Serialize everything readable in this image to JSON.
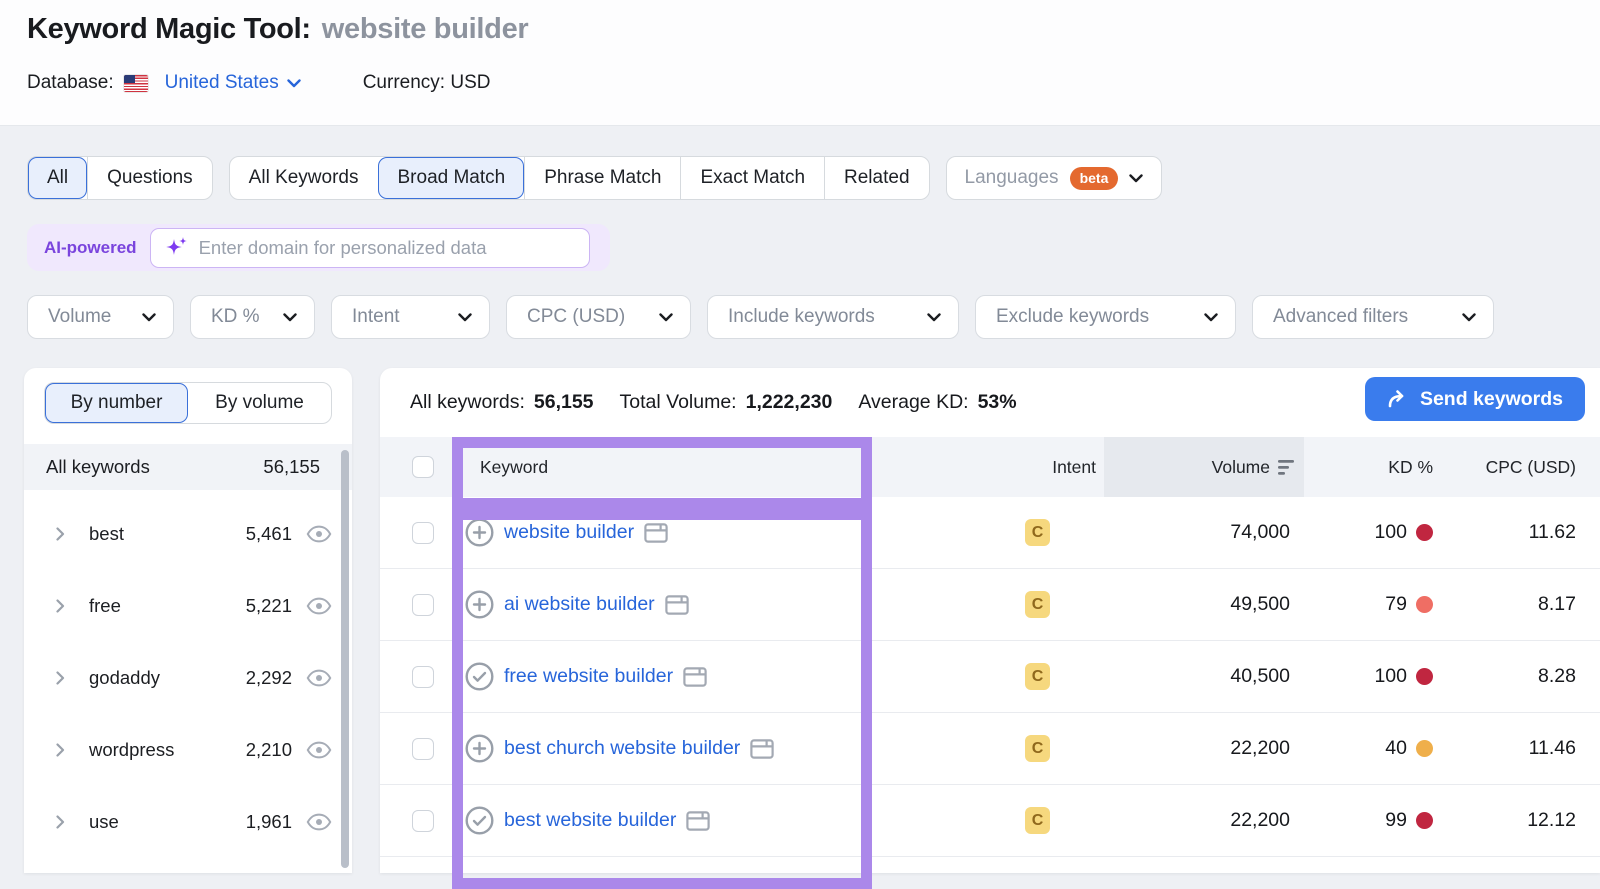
{
  "header": {
    "title": "Keyword Magic Tool:",
    "query": "website builder",
    "database_label": "Database:",
    "database_value": "United States",
    "currency_label": "Currency:",
    "currency_value": "USD"
  },
  "match_tabs": {
    "group1": [
      {
        "label": "All",
        "selected": true
      },
      {
        "label": "Questions",
        "selected": false
      }
    ],
    "group2": [
      {
        "label": "All Keywords",
        "selected": false
      },
      {
        "label": "Broad Match",
        "selected": true
      },
      {
        "label": "Phrase Match",
        "selected": false
      },
      {
        "label": "Exact Match",
        "selected": false
      },
      {
        "label": "Related",
        "selected": false
      }
    ],
    "languages": {
      "label": "Languages",
      "badge": "beta"
    }
  },
  "ai_bar": {
    "label": "AI-powered",
    "placeholder": "Enter domain for personalized data"
  },
  "filters": {
    "volume": "Volume",
    "kd": "KD %",
    "intent": "Intent",
    "cpc": "CPC (USD)",
    "include": "Include keywords",
    "exclude": "Exclude keywords",
    "advanced": "Advanced filters"
  },
  "sidebar": {
    "tabs": [
      {
        "label": "By number",
        "selected": true
      },
      {
        "label": "By volume",
        "selected": false
      }
    ],
    "all_row": {
      "label": "All keywords",
      "count": "56,155"
    },
    "groups": [
      {
        "label": "best",
        "count": "5,461"
      },
      {
        "label": "free",
        "count": "5,221"
      },
      {
        "label": "godaddy",
        "count": "2,292"
      },
      {
        "label": "wordpress",
        "count": "2,210"
      },
      {
        "label": "use",
        "count": "1,961"
      }
    ]
  },
  "summary": {
    "all_keywords_label": "All keywords:",
    "all_keywords_value": "56,155",
    "total_volume_label": "Total Volume:",
    "total_volume_value": "1,222,230",
    "avg_kd_label": "Average KD:",
    "avg_kd_value": "53%",
    "send_button": "Send keywords"
  },
  "table": {
    "columns": {
      "keyword": "Keyword",
      "intent": "Intent",
      "volume": "Volume",
      "kd": "KD %",
      "cpc": "CPC (USD)"
    },
    "rows": [
      {
        "keyword": "website builder",
        "added": false,
        "intent": "C",
        "volume": "74,000",
        "kd": "100",
        "kd_color": "#c02640",
        "cpc": "11.62"
      },
      {
        "keyword": "ai website builder",
        "added": false,
        "intent": "C",
        "volume": "49,500",
        "kd": "79",
        "kd_color": "#ef6e64",
        "cpc": "8.17"
      },
      {
        "keyword": "free website builder",
        "added": true,
        "intent": "C",
        "volume": "40,500",
        "kd": "100",
        "kd_color": "#c02640",
        "cpc": "8.28"
      },
      {
        "keyword": "best church website builder",
        "added": false,
        "intent": "C",
        "volume": "22,200",
        "kd": "40",
        "kd_color": "#efaf4b",
        "cpc": "11.46"
      },
      {
        "keyword": "best website builder",
        "added": true,
        "intent": "C",
        "volume": "22,200",
        "kd": "99",
        "kd_color": "#c02640",
        "cpc": "12.12"
      }
    ]
  },
  "colors": {
    "accent_blue": "#3a7ced",
    "link_blue": "#2765da",
    "annotation_purple": "#ab88ea",
    "intent_commercial": "#f6d87e",
    "ai_purple": "#7a44dd",
    "ai_purple_bg": "#f0e8fd",
    "beta_orange": "#e4692f",
    "page_bg": "#eef0f4"
  }
}
